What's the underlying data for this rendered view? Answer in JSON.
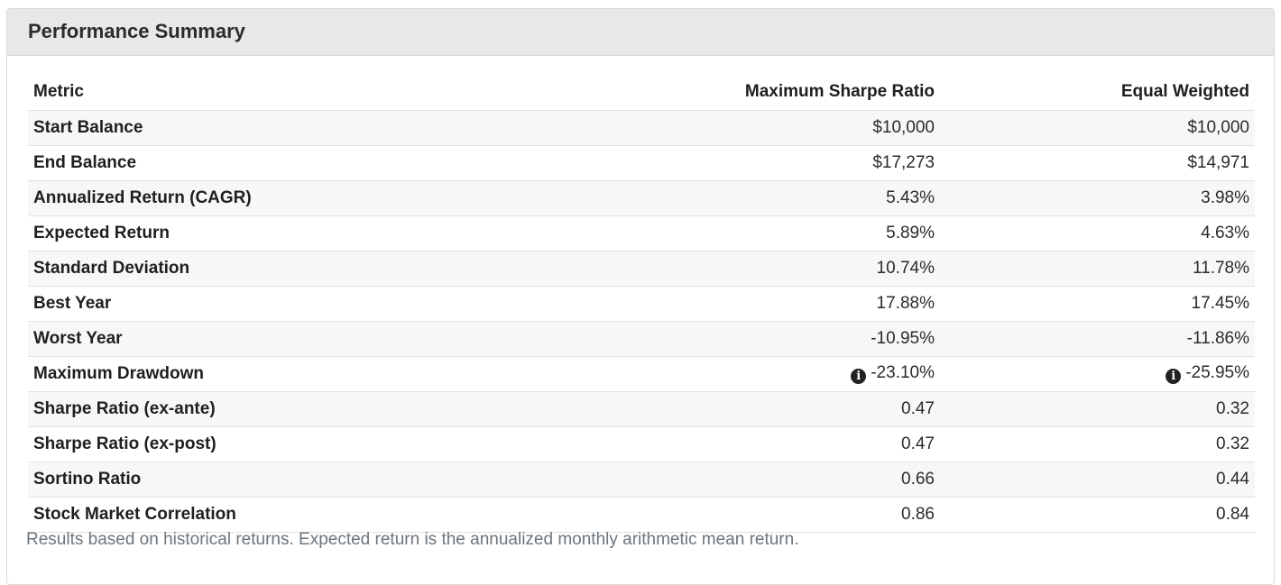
{
  "panel": {
    "title": "Performance Summary"
  },
  "table": {
    "headers": [
      "Metric",
      "Maximum Sharpe Ratio",
      "Equal Weighted"
    ],
    "rows": [
      {
        "metric": "Start Balance",
        "a": "$10,000",
        "b": "$10,000"
      },
      {
        "metric": "End Balance",
        "a": "$17,273",
        "b": "$14,971"
      },
      {
        "metric": "Annualized Return (CAGR)",
        "a": "5.43%",
        "b": "3.98%"
      },
      {
        "metric": "Expected Return",
        "a": "5.89%",
        "b": "4.63%"
      },
      {
        "metric": "Standard Deviation",
        "a": "10.74%",
        "b": "11.78%"
      },
      {
        "metric": "Best Year",
        "a": "17.88%",
        "b": "17.45%"
      },
      {
        "metric": "Worst Year",
        "a": "-10.95%",
        "b": "-11.86%"
      },
      {
        "metric": "Maximum Drawdown",
        "a": "-23.10%",
        "b": "-25.95%"
      },
      {
        "metric": "Sharpe Ratio (ex-ante)",
        "a": "0.47",
        "b": "0.32"
      },
      {
        "metric": "Sharpe Ratio (ex-post)",
        "a": "0.47",
        "b": "0.32"
      },
      {
        "metric": "Sortino Ratio",
        "a": "0.66",
        "b": "0.44"
      },
      {
        "metric": "Stock Market Correlation",
        "a": "0.86",
        "b": "0.84"
      }
    ]
  },
  "icons": {
    "info": "info-circle-icon",
    "info_glyph": "i"
  },
  "footnote": "Results based on historical returns. Expected return is the annualized monthly arithmetic mean return."
}
